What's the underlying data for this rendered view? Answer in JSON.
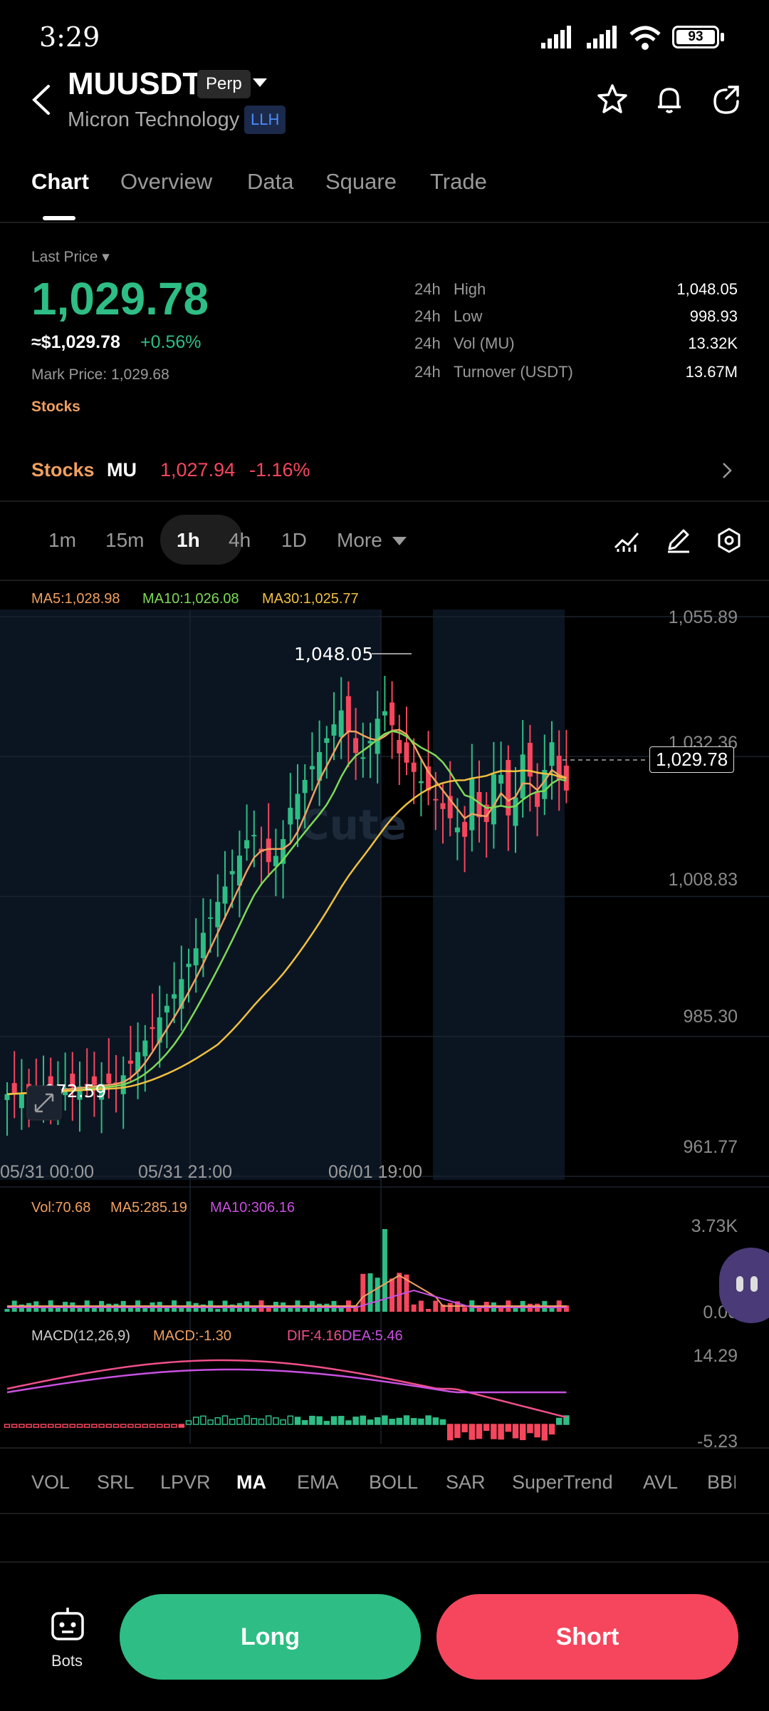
{
  "status_bar": {
    "time": "3:29",
    "battery": "93"
  },
  "header": {
    "symbol": "MUUSDT",
    "contract_type": "Perp",
    "company": "Micron Technology",
    "tag": "LLH"
  },
  "tabs": [
    {
      "label": "Chart",
      "active": true
    },
    {
      "label": "Overview"
    },
    {
      "label": "Data"
    },
    {
      "label": "Square"
    },
    {
      "label": "Trade"
    }
  ],
  "price_panel": {
    "last_price_label": "Last Price",
    "last_price": "1,029.78",
    "usd_price": "≈$1,029.78",
    "change_pct": "+0.56%",
    "mark_price": "Mark Price: 1,029.68",
    "category": "Stocks",
    "stats": [
      {
        "period": "24h",
        "name": "High",
        "value": "1,048.05"
      },
      {
        "period": "24h",
        "name": "Low",
        "value": "998.93"
      },
      {
        "period": "24h",
        "name": "Vol (MU)",
        "value": "13.32K"
      },
      {
        "period": "24h",
        "name": "Turnover (USDT)",
        "value": "13.67M"
      }
    ]
  },
  "stocks_row": {
    "label": "Stocks",
    "ticker": "MU",
    "price": "1,027.94",
    "change": "-1.16%"
  },
  "timeframes": [
    "1m",
    "15m",
    "1h",
    "4h",
    "1D",
    "More"
  ],
  "active_timeframe": "1h",
  "chart": {
    "ma_legend": {
      "ma5": "MA5:1,028.98",
      "ma10": "MA10:1,026.08",
      "ma30": "MA30:1,025.77"
    },
    "y_labels": [
      "1,055.89",
      "1,032.36",
      "1,008.83",
      "985.30",
      "961.77"
    ],
    "x_labels": [
      "05/31 00:00",
      "05/31 21:00",
      "06/01 19:00"
    ],
    "high_label": "1,048.05",
    "low_label": "972.59",
    "current_price": "1,029.78",
    "watermark": "Cute"
  },
  "volume": {
    "legend": {
      "vol": "Vol:70.68",
      "ma5": "MA5:285.19",
      "ma10": "MA10:306.16"
    },
    "y_labels": [
      "3.73K",
      "0.00"
    ]
  },
  "macd": {
    "legend": {
      "name": "MACD(12,26,9)",
      "macd": "MACD:-1.30",
      "dif": "DIF:4.16",
      "dea": "DEA:5.46"
    },
    "y_labels": [
      "14.29",
      "-5.23"
    ]
  },
  "indicators": [
    "VOL",
    "SRL",
    "LPVR",
    "MA",
    "EMA",
    "BOLL",
    "SAR",
    "SuperTrend",
    "AVL",
    "BBI"
  ],
  "active_indicator": "MA",
  "bottom": {
    "bots_label": "Bots",
    "long_label": "Long",
    "short_label": "Short"
  },
  "colors": {
    "up": "#2ebd85",
    "down": "#f6465d",
    "ma5": "#f0a060",
    "ma10": "#7ed957",
    "ma30": "#f0c040",
    "accent_orange": "#f0a060"
  },
  "chart_data": {
    "type": "candlestick",
    "interval": "1h",
    "ylim": [
      961.77,
      1055.89
    ],
    "y_ticks": [
      1055.89,
      1032.36,
      1008.83,
      985.3,
      961.77
    ],
    "x_ticks": [
      "05/31 00:00",
      "05/31 21:00",
      "06/01 19:00"
    ],
    "series": [
      {
        "name": "MA5",
        "value": 1028.98
      },
      {
        "name": "MA10",
        "value": 1026.08
      },
      {
        "name": "MA30",
        "value": 1025.77
      }
    ],
    "annotations": {
      "high": 1048.05,
      "low": 972.59,
      "last": 1029.78
    }
  }
}
